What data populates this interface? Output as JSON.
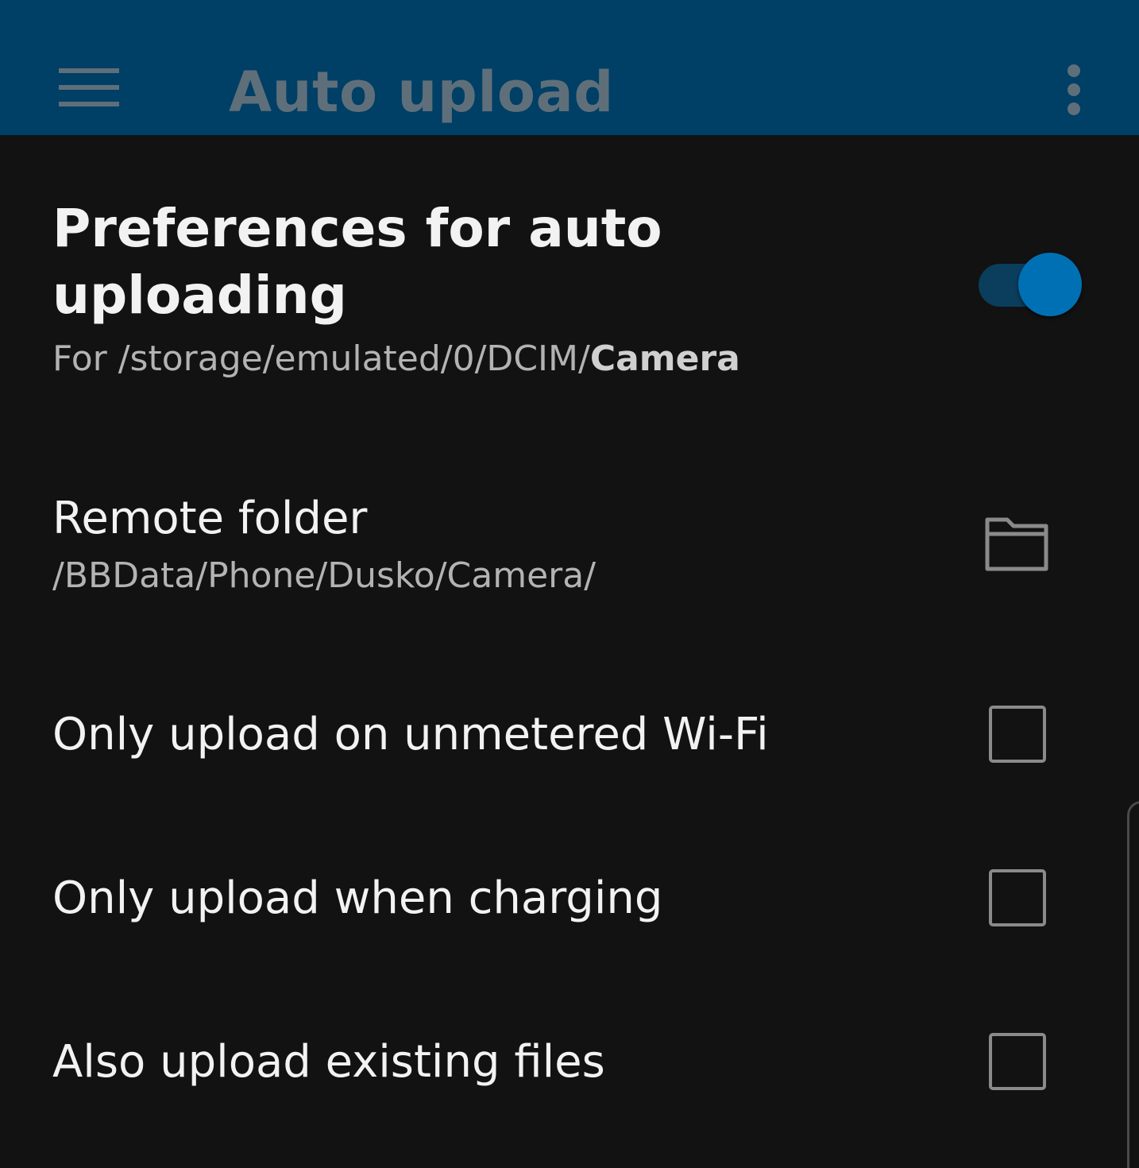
{
  "appbar": {
    "title": "Auto upload",
    "menu_icon": "hamburger-menu-icon",
    "overflow_icon": "more-vert-icon",
    "background": "#003f66"
  },
  "main_pref": {
    "title": "Preferences for auto uploading",
    "summary_prefix": "For /storage/emulated/0/DCIM/",
    "summary_bold": "Camera",
    "enabled": true,
    "accent": "#0070b5"
  },
  "remote_folder": {
    "title": "Remote folder",
    "summary": "/BBData/Phone/Dusko/Camera/",
    "icon": "folder-icon"
  },
  "options": [
    {
      "label": "Only upload on unmetered Wi-Fi",
      "checked": false
    },
    {
      "label": "Only upload when charging",
      "checked": false
    },
    {
      "label": "Also upload existing files",
      "checked": false
    }
  ]
}
